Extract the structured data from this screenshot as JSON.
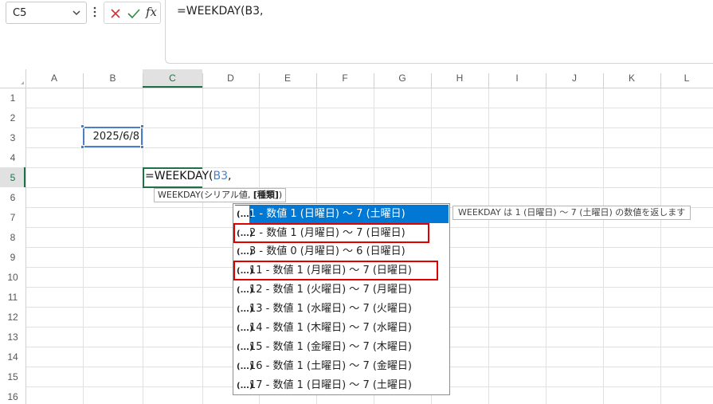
{
  "formula_bar": {
    "name_box": "C5",
    "fx_label": "fx",
    "formula": "=WEEKDAY(B3,"
  },
  "columns": [
    "A",
    "B",
    "C",
    "D",
    "E",
    "F",
    "G",
    "H",
    "I",
    "J",
    "K",
    "L"
  ],
  "rows": [
    "1",
    "2",
    "3",
    "4",
    "5",
    "6",
    "7",
    "8",
    "9",
    "10",
    "11",
    "12",
    "13",
    "14",
    "15",
    "16"
  ],
  "selected": {
    "column": "C",
    "row": "5"
  },
  "cells": {
    "b3": "2025/6/8",
    "c5_func": "=WEEKDAY(",
    "c5_ref": "B3",
    "c5_tail": ","
  },
  "tooltip": {
    "prefix": "WEEKDAY(シリアル値, ",
    "current_arg": "[種類]",
    "suffix": ")"
  },
  "dropdown": {
    "icon_glyph": "(...)",
    "items": [
      "1 - 数値 1 (日曜日) ～ 7 (土曜日)",
      "2 - 数値 1 (月曜日) ～ 7 (日曜日)",
      "3 - 数値 0 (月曜日) ～ 6 (日曜日)",
      "11 - 数値 1 (月曜日) ～ 7 (日曜日)",
      "12 - 数値 1 (火曜日) ～ 7 (月曜日)",
      "13 - 数値 1 (水曜日) ～ 7 (火曜日)",
      "14 - 数値 1 (木曜日) ～ 7 (水曜日)",
      "15 - 数値 1 (金曜日) ～ 7 (木曜日)",
      "16 - 数値 1 (土曜日) ～ 7 (金曜日)",
      "17 - 数値 1 (日曜日) ～ 7 (土曜日)"
    ],
    "selected_index": 0,
    "highlighted_indices": [
      1,
      3
    ]
  },
  "description": "WEEKDAY は 1 (日曜日) ～ 7 (土曜日) の数値を返します",
  "colors": {
    "accent_green": "#1e7145",
    "selection_blue": "#0078d4",
    "reference_blue": "#4a7ec9",
    "highlight_red": "#e00000"
  }
}
